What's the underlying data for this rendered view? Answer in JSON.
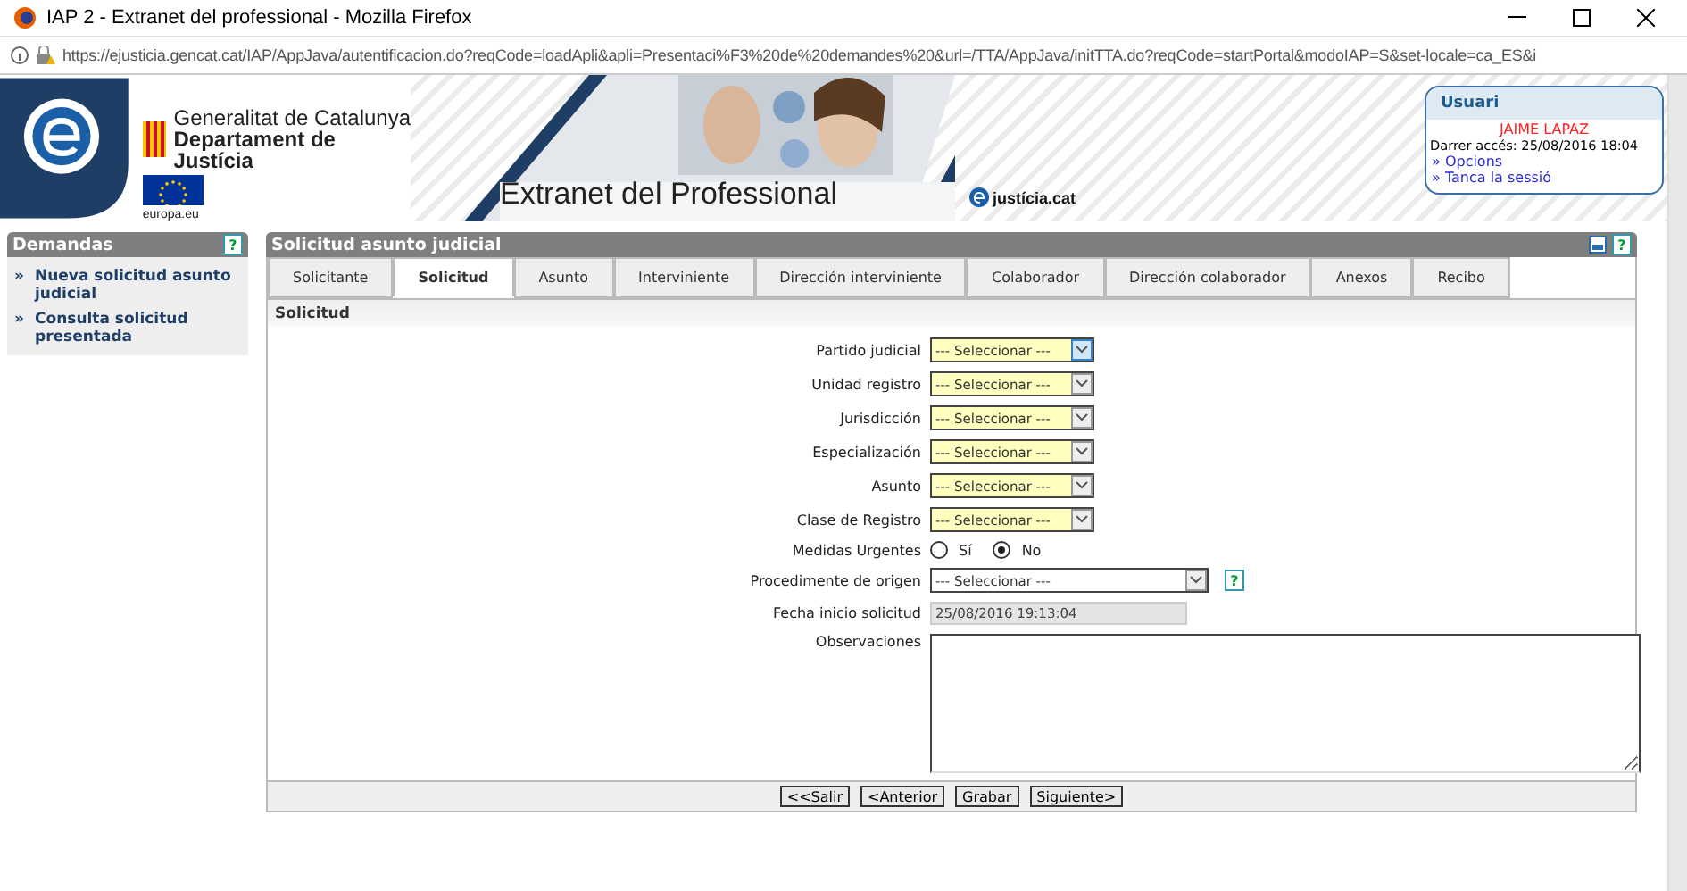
{
  "window": {
    "title": "IAP 2 - Extranet del professional - Mozilla Firefox"
  },
  "address_bar": {
    "url": "https://ejusticia.gencat.cat/IAP/AppJava/autentificacion.do?reqCode=loadApli&apli=Presentaci%F3%20de%20demandes%20&url=/TTA/AppJava/initTTA.do?reqCode=startPortal&modoIAP=S&set-locale=ca_ES&i"
  },
  "banner": {
    "org_line_1": "Generalitat de Catalunya",
    "org_line_2": "Departament de Justícia",
    "eu_caption": "europa.eu",
    "title": "Extranet del Professional",
    "brand": "justícia.cat"
  },
  "user_box": {
    "title": "Usuari",
    "name": "JAIME LAPAZ",
    "last_access": "Darrer accés: 25/08/2016 18:04",
    "links": [
      "» Opcions",
      "» Tanca la sessió"
    ]
  },
  "sidebar": {
    "title": "Demandas",
    "help": "?",
    "items": [
      {
        "bullet": "»",
        "label": "Nueva solicitud asunto judicial"
      },
      {
        "bullet": "»",
        "label": "Consulta solicitud presentada"
      }
    ]
  },
  "panel": {
    "title": "Solicitud asunto judicial",
    "help": "?",
    "tabs": [
      {
        "label": "Solicitante",
        "selected": false
      },
      {
        "label": "Solicitud",
        "selected": true
      },
      {
        "label": "Asunto",
        "selected": false
      },
      {
        "label": "Interviniente",
        "selected": false
      },
      {
        "label": "Dirección interviniente",
        "selected": false
      },
      {
        "label": "Colaborador",
        "selected": false
      },
      {
        "label": "Dirección colaborador",
        "selected": false
      },
      {
        "label": "Anexos",
        "selected": false
      },
      {
        "label": "Recibo",
        "selected": false
      }
    ],
    "section_title": "Solicitud",
    "fields": [
      {
        "kind": "select",
        "label": "Partido judicial",
        "value": "--- Seleccionar ---",
        "focused": true
      },
      {
        "kind": "select",
        "label": "Unidad registro",
        "value": "--- Seleccionar ---",
        "focused": false
      },
      {
        "kind": "select",
        "label": "Jurisdicción",
        "value": "--- Seleccionar ---",
        "focused": false
      },
      {
        "kind": "select",
        "label": "Especialización",
        "value": "--- Seleccionar ---",
        "focused": false
      },
      {
        "kind": "select",
        "label": "Asunto",
        "value": "--- Seleccionar ---",
        "focused": false
      },
      {
        "kind": "select",
        "label": "Clase de Registro",
        "value": "--- Seleccionar ---",
        "focused": false
      },
      {
        "kind": "radio",
        "label": "Medidas Urgentes",
        "options": [
          {
            "label": "Sí",
            "selected": false
          },
          {
            "label": "No",
            "selected": true
          }
        ]
      },
      {
        "kind": "wide-select",
        "label": "Procedimente de origen",
        "value": "--- Seleccionar ---",
        "help": "?"
      },
      {
        "kind": "readonly",
        "label": "Fecha inicio solicitud",
        "value": "25/08/2016 19:13:04"
      },
      {
        "kind": "textarea",
        "label": "Observaciones"
      }
    ],
    "buttons": [
      "<<Salir",
      "<Anterior",
      "Grabar",
      "Siguiente>"
    ]
  }
}
